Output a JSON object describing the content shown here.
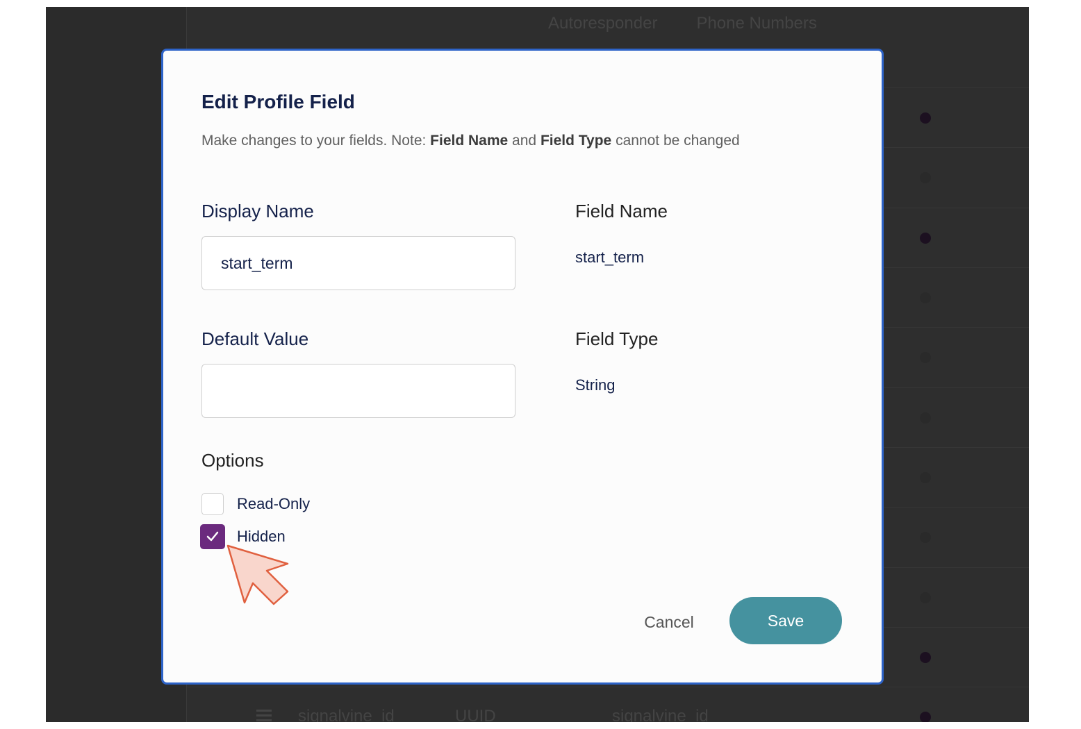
{
  "background": {
    "tabs": [
      "Autoresponder",
      "Phone Numbers"
    ],
    "bottom_row": {
      "icon": "hamburger-icon",
      "cells": [
        "signalvine_id",
        "UUID",
        "signalvine_id"
      ]
    }
  },
  "modal": {
    "title": "Edit Profile Field",
    "subtitle_prefix": "Make changes to your fields. Note: ",
    "subtitle_field_name": "Field Name",
    "subtitle_and": " and ",
    "subtitle_field_type": "Field Type",
    "subtitle_suffix": " cannot be changed",
    "display_name": {
      "label": "Display Name",
      "value": "start_term"
    },
    "field_name": {
      "label": "Field Name",
      "value": "start_term"
    },
    "default_value": {
      "label": "Default Value",
      "value": ""
    },
    "field_type": {
      "label": "Field Type",
      "value": "String"
    },
    "options": {
      "title": "Options",
      "items": [
        {
          "label": "Read-Only",
          "checked": false
        },
        {
          "label": "Hidden",
          "checked": true
        }
      ]
    },
    "cancel_label": "Cancel",
    "save_label": "Save"
  },
  "colors": {
    "modal_border": "#2d63c8",
    "checkbox_checked": "#6b2a7e",
    "save_button": "#45929f",
    "heading": "#14214a"
  }
}
